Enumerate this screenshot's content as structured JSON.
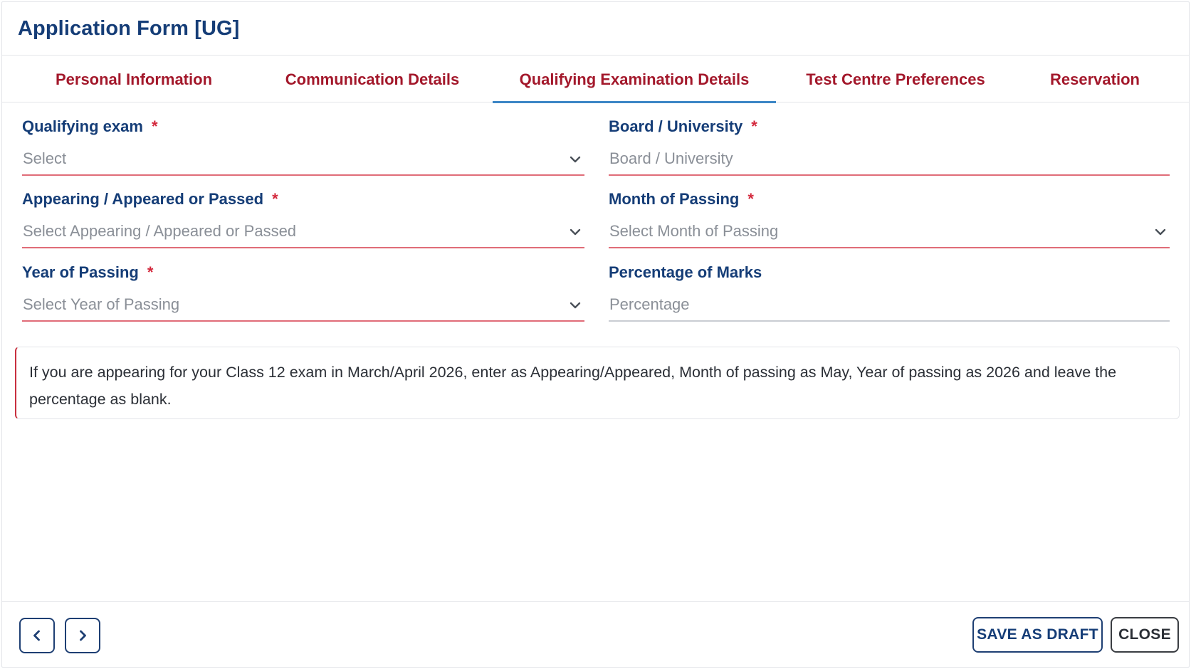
{
  "header": {
    "title": "Application Form [UG]"
  },
  "tabs": [
    {
      "label": "Personal Information",
      "active": false
    },
    {
      "label": "Communication Details",
      "active": false
    },
    {
      "label": "Qualifying Examination Details",
      "active": true
    },
    {
      "label": "Test Centre Preferences",
      "active": false
    },
    {
      "label": "Reservation",
      "active": false
    }
  ],
  "form": {
    "required_mark": "*",
    "qualifying_exam": {
      "label": "Qualifying exam",
      "placeholder": "Select",
      "required": true,
      "type": "select"
    },
    "board_university": {
      "label": "Board / University",
      "placeholder": "Board / University",
      "required": true,
      "type": "text"
    },
    "appearing_status": {
      "label": "Appearing / Appeared or Passed",
      "placeholder": "Select Appearing / Appeared or Passed",
      "required": true,
      "type": "select"
    },
    "month_of_passing": {
      "label": "Month of Passing",
      "placeholder": "Select Month of Passing",
      "required": true,
      "type": "select"
    },
    "year_of_passing": {
      "label": "Year of Passing",
      "placeholder": "Select Year of Passing",
      "required": true,
      "type": "select"
    },
    "percentage_of_marks": {
      "label": "Percentage of Marks",
      "placeholder": "Percentage",
      "required": false,
      "type": "text"
    }
  },
  "note": {
    "text": "If you are appearing for your Class 12 exam in March/April 2026, enter as Appearing/Appeared, Month of passing as May, Year of passing as 2026 and leave the percentage as blank."
  },
  "footer": {
    "prev_icon": "chevron-left-icon",
    "next_icon": "chevron-right-icon",
    "save_draft_label": "SAVE AS DRAFT",
    "close_label": "CLOSE"
  },
  "colors": {
    "primary": "#153d77",
    "tab_text": "#a3182b",
    "active_tab_underline": "#3d86c6",
    "required": "#d3283c",
    "error_underline": "#e06c78"
  }
}
